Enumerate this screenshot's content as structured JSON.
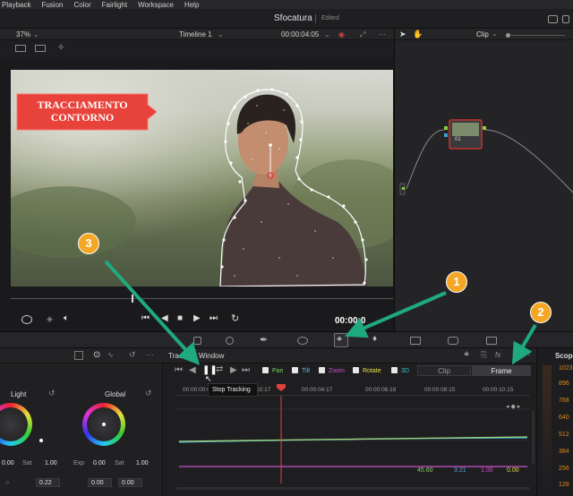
{
  "menu": [
    "Playback",
    "Fusion",
    "Color",
    "Fairlight",
    "Workspace",
    "Help"
  ],
  "project": {
    "title": "Sfocatura",
    "status": "Edited"
  },
  "viewer": {
    "zoom": "37%",
    "timeline": "Timeline 1",
    "timecode_top": "00:00:04:05",
    "timecode": "00:00:0",
    "annotation": "TRACCIAMENTO\nCONTORNO"
  },
  "nodes": {
    "mode": "Clip",
    "node_label": "01"
  },
  "tracker": {
    "title": "Tracker - Window",
    "options": [
      {
        "label": "Pan",
        "color": "#7fd35f"
      },
      {
        "label": "Tilt",
        "color": "#56b9e9"
      },
      {
        "label": "Zoom",
        "color": "#d74dd3"
      },
      {
        "label": "Rotate",
        "color": "#e9e248"
      },
      {
        "label": "3D",
        "color": "#38c7c7"
      }
    ],
    "modes": [
      "Clip",
      "Frame"
    ],
    "tooltip": "Stop Tracking",
    "ruler": [
      "00:00:00:00",
      "00:00:02:17",
      "00:00:04:17",
      "00:00:06:18",
      "00:00:08:15",
      "00:00:10:15"
    ],
    "values": [
      {
        "v": "45.60",
        "color": "#8fcf6a"
      },
      {
        "v": "3.21",
        "color": "#5aa6e0"
      },
      {
        "v": "1.00",
        "color": "#d34fd0"
      },
      {
        "v": "0.00",
        "color": "#e3dd47"
      }
    ]
  },
  "color_wheels": {
    "light": {
      "label": "Light",
      "v1": "0.00",
      "sat_label": "Sat",
      "sat": "1.00",
      "v2": "0.22"
    },
    "global": {
      "label": "Global",
      "exp_label": "Exp",
      "exp": "0.00",
      "sat_label": "Sat",
      "sat": "1.00",
      "v1": "0.00",
      "v2": "0.00"
    }
  },
  "scopes": {
    "label": "Scope",
    "ticks": [
      "1023",
      "896",
      "768",
      "640",
      "512",
      "384",
      "256",
      "128"
    ]
  },
  "badges": [
    "1",
    "2",
    "3"
  ],
  "colors": {
    "accent": "#f5a623",
    "arrow": "#1fa97f",
    "callout": "#e8433a",
    "playhead": "#e2413b"
  }
}
